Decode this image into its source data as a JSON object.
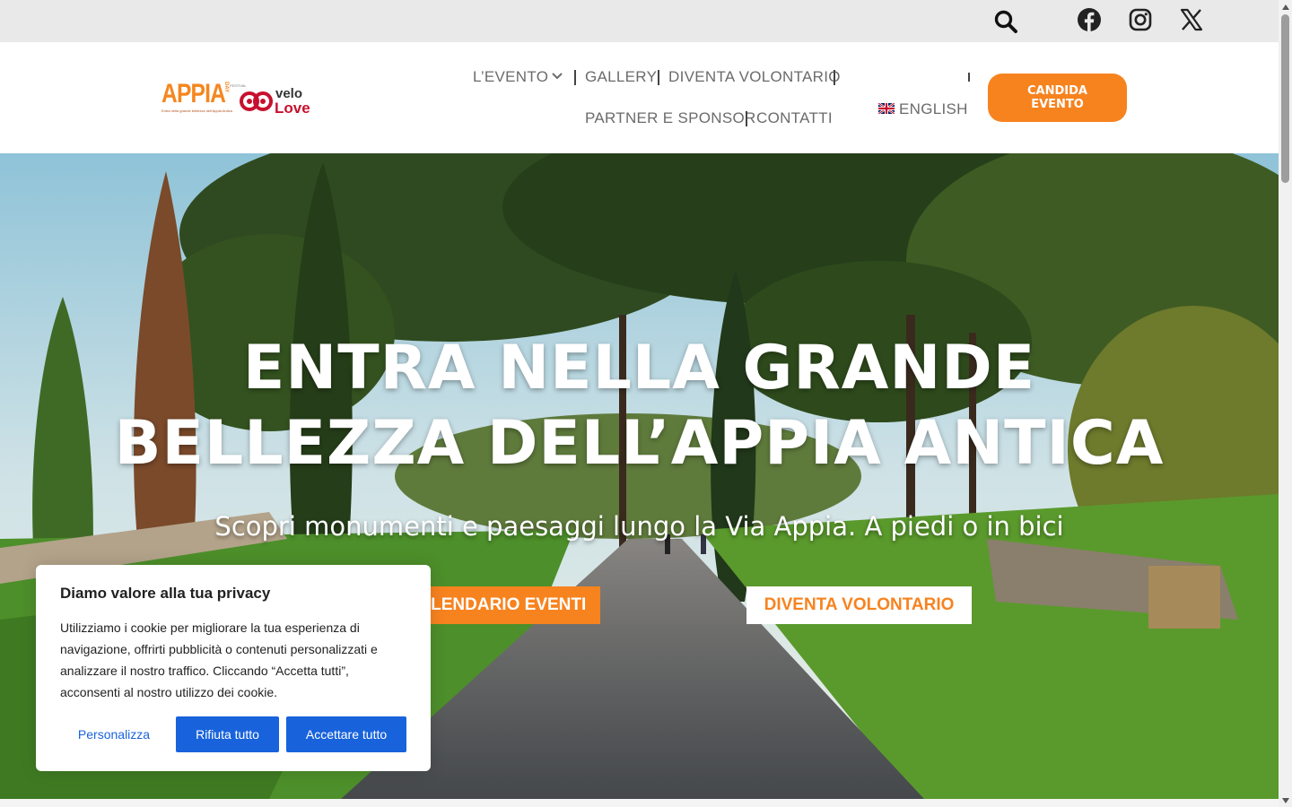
{
  "topbar": {
    "icons": [
      "search-icon",
      "facebook-icon",
      "instagram-icon",
      "x-icon"
    ]
  },
  "header": {
    "logo": {
      "appia": "APPIA",
      "day": "DAY",
      "festival": "FESTIVAL",
      "tagline": "Entra nella grande bellezza dell'Appia Antica",
      "velo": "velo",
      "love": "Love"
    },
    "nav": {
      "evento": "L’EVENTO",
      "gallery": "GALLERY",
      "volontario": "DIVENTA VOLONTARIO",
      "partner": "PARTNER E SPONSOR",
      "contatti": "CONTATTI",
      "language": "ENGLISH"
    },
    "cta_label": "CANDIDA EVENTO"
  },
  "hero": {
    "title_line1": "ENTRA NELLA GRANDE",
    "title_line2": "BELLEZZA DELL’APPIA ANTICA",
    "subtitle": "Scopri monumenti e paesaggi lungo la Via Appia. A piedi o in bici",
    "btn_calendar": "CALENDARIO EVENTI",
    "btn_volunteer": "DIVENTA VOLONTARIO"
  },
  "cookie": {
    "title": "Diamo valore alla tua privacy",
    "text": "Utilizziamo i cookie per migliorare la tua esperienza di navigazione, offrirti pubblicità o contenuti personalizzati e analizzare il nostro traffico. Cliccando “Accetta tutti”, acconsenti al nostro utilizzo dei cookie.",
    "btn_customize": "Personalizza",
    "btn_reject": "Rifiuta tutto",
    "btn_accept": "Accettare tutto"
  },
  "colors": {
    "accent_orange": "#f7831f",
    "cookie_blue": "#1863dc",
    "topbar_bg": "#e9e9e9",
    "nav_text": "#6b6b6b"
  }
}
